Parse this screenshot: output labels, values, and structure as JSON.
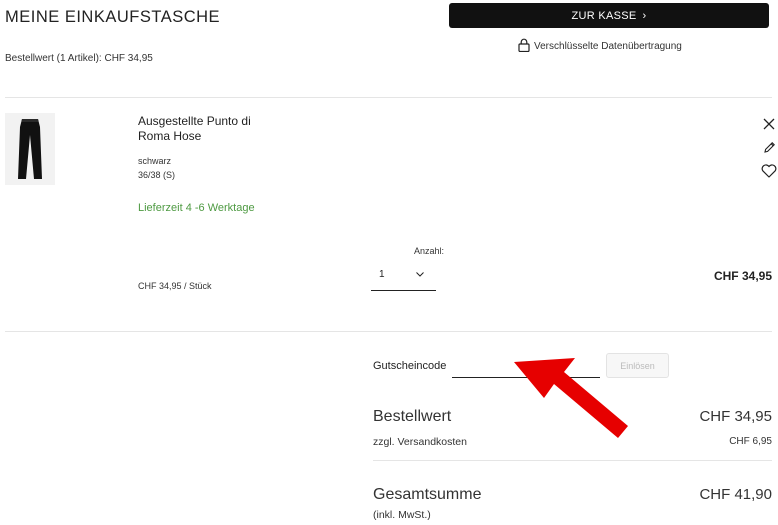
{
  "header": {
    "title": "MEINE EINKAUFSTASCHE",
    "order_value_summary": "Bestellwert (1 Artikel): CHF 34,95",
    "checkout_label": "ZUR KASSE",
    "secure_text": "Verschlüsselte Datenübertragung"
  },
  "cart_item": {
    "name": "Ausgestellte Punto di Roma Hose",
    "color": "schwarz",
    "size": "36/38 (S)",
    "delivery": "Lieferzeit 4 -6 Werktage",
    "unit_price": "CHF 34,95 / Stück",
    "quantity_label": "Anzahl:",
    "quantity": "1",
    "line_total": "CHF 34,95",
    "thumbnail_icon": "trousers-icon"
  },
  "actions": {
    "remove_icon": "close-icon",
    "edit_icon": "pencil-icon",
    "wishlist_icon": "heart-icon"
  },
  "voucher": {
    "label": "Gutscheincode",
    "input_value": "",
    "redeem_label": "Einlösen"
  },
  "summary": {
    "order_value_label": "Bestellwert",
    "order_value": "CHF 34,95",
    "shipping_label": "zzgl. Versandkosten",
    "shipping_value": "CHF 6,95",
    "total_label": "Gesamtsumme",
    "total_note": "(inkl. MwSt.)",
    "total_value": "CHF 41,90"
  },
  "colors": {
    "accent": "#111111",
    "delivery_green": "#4e9a42",
    "annotation_red": "#e60000"
  }
}
